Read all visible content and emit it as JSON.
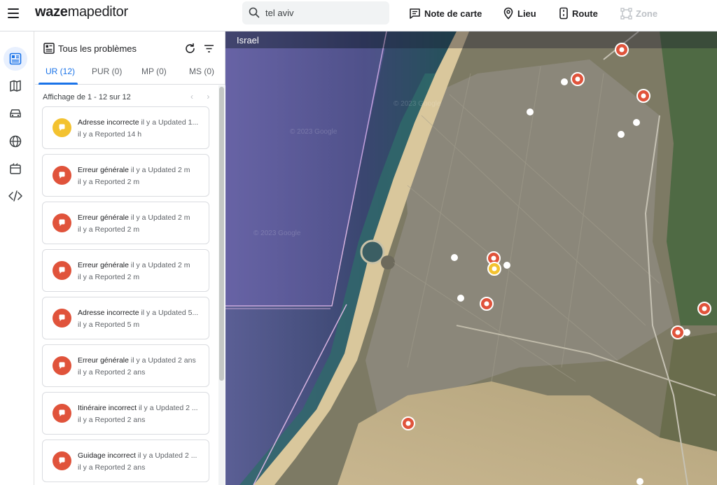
{
  "app": {
    "logo_bold": "waze",
    "logo_light": "mapeditor"
  },
  "search": {
    "value": "tel aviv",
    "icon": "search-icon"
  },
  "toolbar": {
    "note_label": "Note de carte",
    "place_label": "Lieu",
    "route_label": "Route",
    "zone_label": "Zone"
  },
  "rail": {
    "items": [
      "issues-icon",
      "map-layers-icon",
      "car-icon",
      "globe-icon",
      "events-icon",
      "code-icon"
    ]
  },
  "panel": {
    "title": "Tous les problèmes",
    "tabs": [
      {
        "label": "UR (12)"
      },
      {
        "label": "PUR (0)"
      },
      {
        "label": "MP (0)"
      },
      {
        "label": "MS (0)"
      }
    ],
    "showing": "Affichage de 1 - 12 sur 12",
    "pager": "‹ ›",
    "cards": [
      {
        "type": "Adresse incorrecte",
        "ago1": "il y a",
        "updated": "Updated 1...",
        "ago2": "il y a",
        "reported": "Reported 14 h",
        "color": "#f3c230"
      },
      {
        "type": "Erreur générale",
        "ago1": "il y a",
        "updated": "Updated 2 m",
        "ago2": "il y a",
        "reported": "Reported 2 m",
        "color": "#e0533b"
      },
      {
        "type": "Erreur générale",
        "ago1": "il y a",
        "updated": "Updated 2 m",
        "ago2": "il y a",
        "reported": "Reported 2 m",
        "color": "#e0533b"
      },
      {
        "type": "Erreur générale",
        "ago1": "il y a",
        "updated": "Updated 2 m",
        "ago2": "il y a",
        "reported": "Reported 2 m",
        "color": "#e0533b"
      },
      {
        "type": "Adresse incorrecte",
        "ago1": "il y a",
        "updated": "Updated 5...",
        "ago2": "il y a",
        "reported": "Reported 5 m",
        "color": "#e0533b"
      },
      {
        "type": "Erreur générale",
        "ago1": "il y a",
        "updated": "Updated 2 ans",
        "ago2": "il y a",
        "reported": "Reported 2 ans",
        "color": "#e0533b"
      },
      {
        "type": "Itinéraire incorrect",
        "ago1": "il y a",
        "updated": "Updated 2 ...",
        "ago2": "il y a",
        "reported": "Reported 2 ans",
        "color": "#e0533b"
      },
      {
        "type": "Guidage incorrect",
        "ago1": "il y a",
        "updated": "Updated 2 ...",
        "ago2": "il y a",
        "reported": "Reported 2 ans",
        "color": "#e0533b"
      }
    ]
  },
  "map": {
    "country": "Israel",
    "watermark": "© 2023 Google",
    "sea_color": "#3f4d74",
    "land_color": "#8a8468"
  }
}
